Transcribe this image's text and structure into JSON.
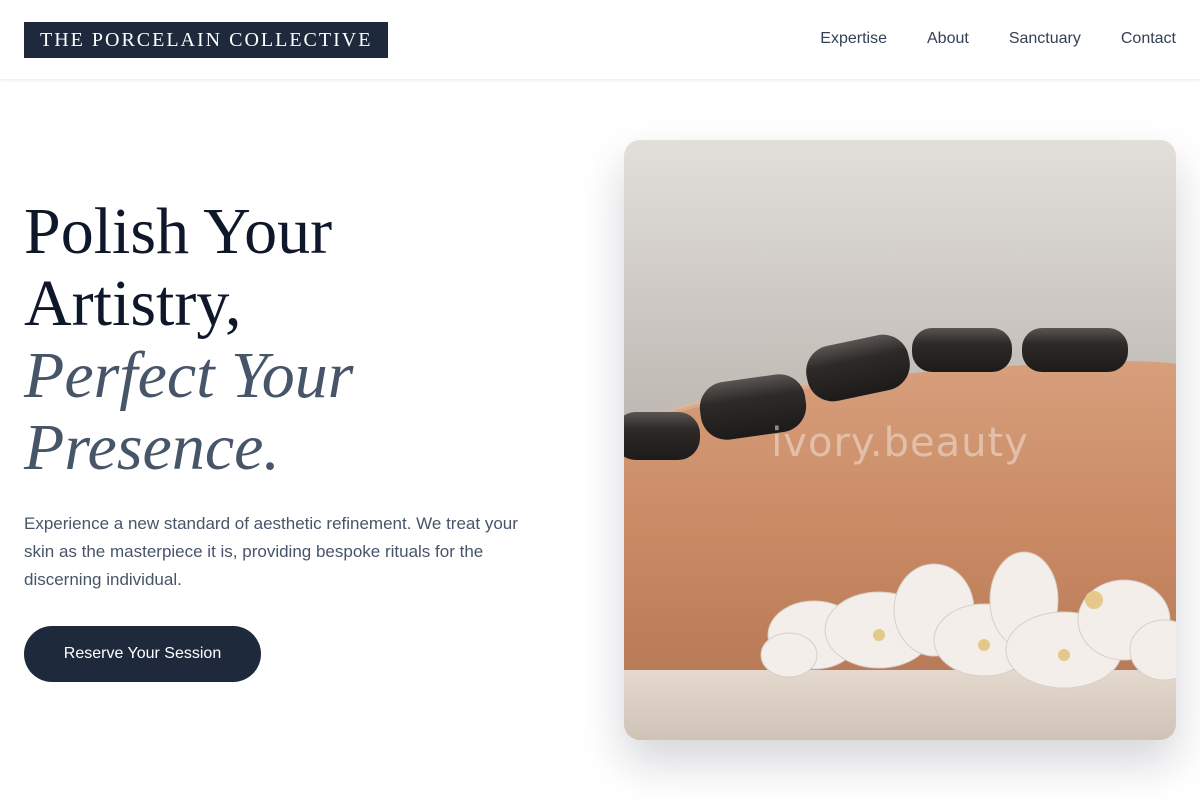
{
  "header": {
    "logo": "THE PORCELAIN COLLECTIVE",
    "nav": [
      "Expertise",
      "About",
      "Sanctuary",
      "Contact"
    ]
  },
  "hero": {
    "headline_line1": "Polish Your",
    "headline_line2": "Artistry,",
    "headline_italic1": "Perfect Your",
    "headline_italic2": "Presence.",
    "description": "Experience a new standard of aesthetic refinement. We treat your skin as the masterpiece it is, providing bespoke rituals for the discerning individual.",
    "cta_label": "Reserve Your Session"
  },
  "image": {
    "subject": "hot-stone-massage-photo",
    "watermark": "ivory.beauty"
  },
  "colors": {
    "navy": "#1e293b",
    "slate": "#475569",
    "heading": "#0f172a"
  }
}
